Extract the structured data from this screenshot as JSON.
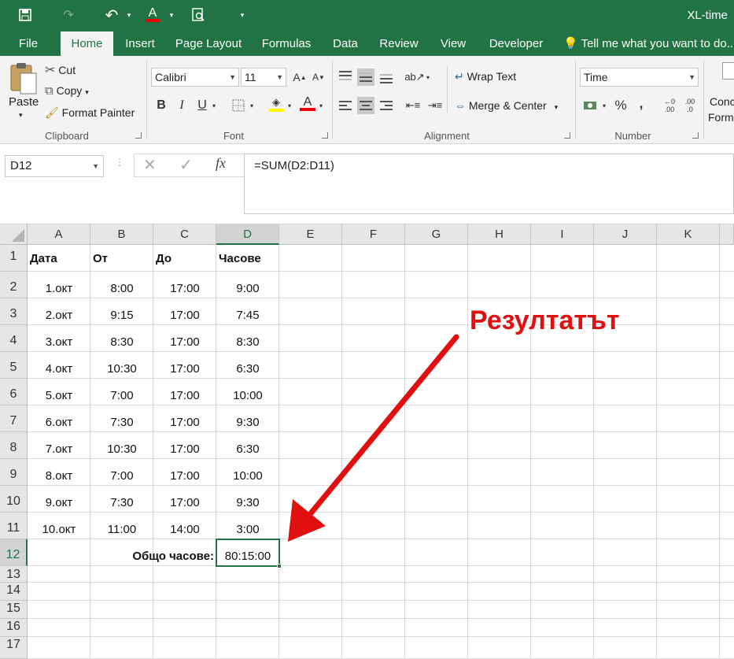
{
  "window": {
    "title": "XL-time"
  },
  "tabs": [
    "File",
    "Home",
    "Insert",
    "Page Layout",
    "Formulas",
    "Data",
    "Review",
    "View",
    "Developer"
  ],
  "tell_me": "Tell me what you want to do...",
  "clipboard": {
    "paste": "Paste",
    "cut": "Cut",
    "copy": "Copy",
    "format_painter": "Format Painter",
    "group": "Clipboard"
  },
  "font": {
    "name": "Calibri",
    "size": "11",
    "bold": "B",
    "italic": "I",
    "underline": "U",
    "font_a": "A",
    "group": "Font"
  },
  "alignment": {
    "wrap": "Wrap Text",
    "merge": "Merge & Center",
    "group": "Alignment"
  },
  "number": {
    "format": "Time",
    "percent": "%",
    "comma": ",",
    "inc_dec": ".00",
    "dec_dec": ".0",
    "group": "Number"
  },
  "styles": {
    "cond1": "Conc",
    "cond2": "Form"
  },
  "formula_bar": {
    "name_box": "D12",
    "formula": "=SUM(D2:D11)",
    "fx": "fx"
  },
  "columns": [
    "A",
    "B",
    "C",
    "D",
    "E",
    "F",
    "G",
    "H",
    "I",
    "J",
    "K"
  ],
  "rows": [
    "1",
    "2",
    "3",
    "4",
    "5",
    "6",
    "7",
    "8",
    "9",
    "10",
    "11",
    "12",
    "13",
    "14",
    "15",
    "16",
    "17"
  ],
  "headers": {
    "a": "Дата",
    "b": "От",
    "c": "До",
    "d": "Часове"
  },
  "data": [
    {
      "a": "1.окт",
      "b": "8:00",
      "c": "17:00",
      "d": "9:00"
    },
    {
      "a": "2.окт",
      "b": "9:15",
      "c": "17:00",
      "d": "7:45"
    },
    {
      "a": "3.окт",
      "b": "8:30",
      "c": "17:00",
      "d": "8:30"
    },
    {
      "a": "4.окт",
      "b": "10:30",
      "c": "17:00",
      "d": "6:30"
    },
    {
      "a": "5.окт",
      "b": "7:00",
      "c": "17:00",
      "d": "10:00"
    },
    {
      "a": "6.окт",
      "b": "7:30",
      "c": "17:00",
      "d": "9:30"
    },
    {
      "a": "7.окт",
      "b": "10:30",
      "c": "17:00",
      "d": "6:30"
    },
    {
      "a": "8.окт",
      "b": "7:00",
      "c": "17:00",
      "d": "10:00"
    },
    {
      "a": "9.окт",
      "b": "7:30",
      "c": "17:00",
      "d": "9:30"
    },
    {
      "a": "10.окт",
      "b": "11:00",
      "c": "14:00",
      "d": "3:00"
    }
  ],
  "total": {
    "label": "Общо часове:",
    "value": "80:15:00"
  },
  "annotation": {
    "text": "Резултатът",
    "color": "#e01010"
  },
  "colors": {
    "accent": "#217346"
  }
}
